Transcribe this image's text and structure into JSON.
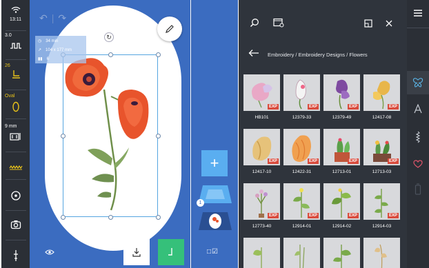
{
  "left_toolbar": {
    "wifi_time": "13:11",
    "stitch_length_value": "3.0",
    "thread_tension_value": "26",
    "presser_foot_label": "Oval",
    "hoop_size_value": "9 mm",
    "colors": {
      "accent": "#e8c21a",
      "bg": "#2b2f36"
    }
  },
  "canvas": {
    "time_value": "34 min",
    "size_value": "104 x 177 mm",
    "colors_count": "6",
    "hoop_color": "#ffffff",
    "bg_color": "#3b6cc0"
  },
  "layers": {
    "add_label": "+",
    "badge_value": "1"
  },
  "library": {
    "breadcrumb": "Embroidery / Embroidery Designs / Flowers",
    "exp_label": "EXP",
    "items": [
      {
        "label": "HB101",
        "has_exp": true
      },
      {
        "label": "12379-33",
        "has_exp": true
      },
      {
        "label": "12379-49",
        "has_exp": true
      },
      {
        "label": "12417-08",
        "has_exp": true
      },
      {
        "label": "12417-10",
        "has_exp": true
      },
      {
        "label": "12422-31",
        "has_exp": true
      },
      {
        "label": "12713-01",
        "has_exp": true
      },
      {
        "label": "12713-03",
        "has_exp": true
      },
      {
        "label": "12773-40",
        "has_exp": true
      },
      {
        "label": "12914-01",
        "has_exp": true
      },
      {
        "label": "12914-02",
        "has_exp": true
      },
      {
        "label": "12914-03",
        "has_exp": true
      },
      {
        "label": "",
        "has_exp": false
      },
      {
        "label": "",
        "has_exp": false
      },
      {
        "label": "",
        "has_exp": false
      },
      {
        "label": "",
        "has_exp": false
      }
    ]
  },
  "right_rail": {
    "icons": [
      "menu-icon",
      "butterfly-icon",
      "font-icon",
      "stitch-icon",
      "heart-icon",
      "thread-icon"
    ]
  }
}
